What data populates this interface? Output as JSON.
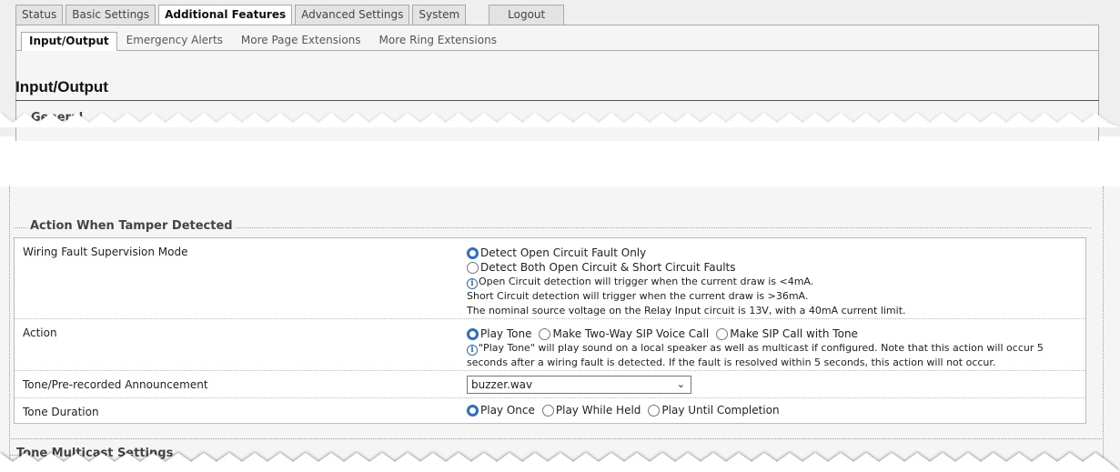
{
  "main_tabs": [
    {
      "label": "Status",
      "active": false
    },
    {
      "label": "Basic Settings",
      "active": false
    },
    {
      "label": "Additional Features",
      "active": true
    },
    {
      "label": "Advanced Settings",
      "active": false
    },
    {
      "label": "System",
      "active": false
    }
  ],
  "logout_label": "Logout",
  "sub_tabs": [
    {
      "label": "Input/Output",
      "active": true
    },
    {
      "label": "Emergency Alerts",
      "active": false
    },
    {
      "label": "More Page Extensions",
      "active": false
    },
    {
      "label": "More Ring Extensions",
      "active": false
    }
  ],
  "page_title": "Input/Output",
  "general_legend": "General",
  "tamper": {
    "legend": "Action When Tamper Detected",
    "wiring": {
      "label": "Wiring Fault Supervision Mode",
      "options": [
        "Detect Open Circuit Fault Only",
        "Detect Both Open Circuit & Short Circuit Faults"
      ],
      "selected": 0,
      "info_icon": "info-circle-icon",
      "info": [
        "Open Circuit detection will trigger when the current draw is <4mA.",
        "Short Circuit detection will trigger when the current draw is >36mA.",
        "The nominal source voltage on the Relay Input circuit is 13V, with a 40mA current limit."
      ]
    },
    "action": {
      "label": "Action",
      "options": [
        "Play Tone",
        "Make Two-Way SIP Voice Call",
        "Make SIP Call with Tone"
      ],
      "selected": 0,
      "info": [
        "\"Play Tone\" will play sound on a local speaker as well as multicast if configured. Note that this action will occur 5",
        "seconds after a wiring fault is detected. If the fault is resolved within 5 seconds, this action will not occur."
      ]
    },
    "tone": {
      "label": "Tone/Pre-recorded Announcement",
      "value": "buzzer.wav",
      "chevron_icon": "chevron-down-icon"
    },
    "duration": {
      "label": "Tone Duration",
      "options": [
        "Play Once",
        "Play While Held",
        "Play Until Completion"
      ],
      "selected": 0
    }
  },
  "tone_multicast_legend": "Tone Multicast Settings",
  "colors": {
    "radio_checked": "#2a6ecb",
    "panel_bg": "#f5f5f5",
    "tab_bg": "#e3e3e3"
  }
}
